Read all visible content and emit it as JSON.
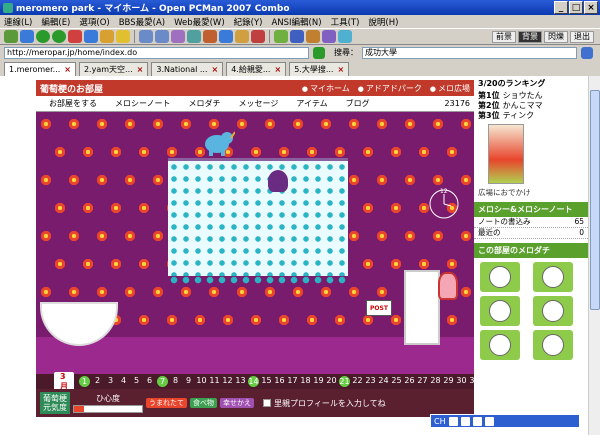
{
  "window": {
    "title": "meromero park - マイホーム - Open PCMan 2007 Combo"
  },
  "menu": [
    "連線(L)",
    "編輯(E)",
    "選項(O)",
    "BBS最愛(A)",
    "Web最愛(W)",
    "紀錄(Y)",
    "ANSI編輯(N)",
    "工具(T)",
    "說明(H)"
  ],
  "toolbar": {
    "btn1": "前景",
    "btn2": "背景",
    "btn3": "閃爍",
    "btn4": "退出"
  },
  "address": {
    "url": "http://meropar.jp/home/index.do",
    "search_label": "搜尋：",
    "search_value": "成功大學"
  },
  "tabs": [
    {
      "label": "1.meromer..."
    },
    {
      "label": "2.yam天空..."
    },
    {
      "label": "3.National ..."
    },
    {
      "label": "4.給親愛..."
    },
    {
      "label": "5.大學搜..."
    }
  ],
  "room": {
    "title": "葡萄梗のお部屋",
    "links": [
      "マイホーム",
      "アドアドパーク",
      "メロ広場"
    ],
    "nav": [
      "お部屋をする",
      "メロシーノート",
      "メロダチ",
      "メッセージ",
      "アイテム",
      "ブログ"
    ],
    "count": "23176",
    "post_label": "POST",
    "clock_label": "12"
  },
  "calendar": {
    "month": "3月",
    "days": [
      "1",
      "2",
      "3",
      "4",
      "5",
      "6",
      "7",
      "8",
      "9",
      "10",
      "11",
      "12",
      "13",
      "14",
      "15",
      "16",
      "17",
      "18",
      "19",
      "20",
      "21",
      "22",
      "23",
      "24",
      "25",
      "26",
      "27",
      "28",
      "29",
      "30",
      "31"
    ],
    "marked": [
      "1",
      "7",
      "14",
      "21"
    ]
  },
  "status": {
    "name": "葡萄梗",
    "subname": "元気度",
    "bar_label": "ひ心度",
    "fill_level": 0.15,
    "btn_a": "うまれたて",
    "btn_b": "食べ物",
    "btn_c": "幸せかえ",
    "checkbox_label": "里親プロフィールを入力してね"
  },
  "right": {
    "ranking_title": "3/20のランキング",
    "ranks": [
      {
        "pos": "第1位",
        "name": "ショウたん"
      },
      {
        "pos": "第2位",
        "name": "かんこママ"
      },
      {
        "pos": "第3位",
        "name": "ティンク"
      }
    ],
    "goto": "広場におでかけ",
    "note_title": "メロシー&メロシーノート",
    "note_rows": [
      {
        "label": "ノートの書込み",
        "value": "65"
      },
      {
        "label": "最近の",
        "value": "0"
      }
    ],
    "friends_title": "この部屋のメロダチ"
  },
  "taskbar": {
    "label": "CH"
  }
}
